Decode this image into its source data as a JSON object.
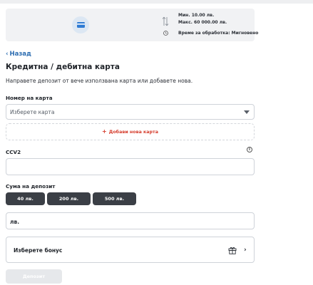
{
  "info_card": {
    "min_limit": "Мин. 10.00 лв.",
    "max_limit": "Макс. 60 000.00 лв.",
    "processing_time": "Време за обработка: Мигновено"
  },
  "nav": {
    "back_label": "Назад"
  },
  "page": {
    "title": "Кредитна / дебитна карта",
    "description": "Направете депозит от вече използвана карта или добавете нова."
  },
  "card_number": {
    "label": "Номер на карта",
    "selected_value": "Изберете карта",
    "add_card_label": "Добави нова карта"
  },
  "ccv2": {
    "label": "CCV2",
    "value": "",
    "info_icon_glyph": "i"
  },
  "deposit_amount": {
    "label": "Сума на депозит",
    "quick_amounts": [
      "40 лв.",
      "200 лв.",
      "500 лв."
    ],
    "input_placeholder": "лв."
  },
  "bonus": {
    "label": "Изберете бонус",
    "chevron": "›"
  },
  "deposit_button": {
    "label": "Депозит",
    "enabled": false
  },
  "colors": {
    "accent_link": "#2b6cb0",
    "add_card_red": "#d53c2c",
    "quick_amount_bg": "#3b3f46",
    "disabled_button_bg": "#e6e8eb"
  },
  "icons": {
    "payment_method": "credit-card-icon",
    "limits": "up-down-arrows-icon",
    "time": "clock-icon",
    "back": "chevron-left-icon",
    "dropdown": "caret-down-icon",
    "add": "plus-icon",
    "info": "info-icon",
    "bonus": "gift-icon",
    "bonus_open": "chevron-right-icon"
  }
}
